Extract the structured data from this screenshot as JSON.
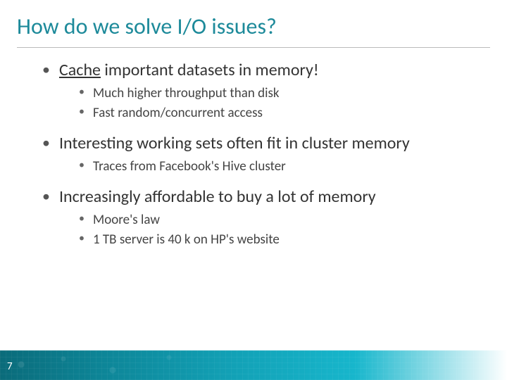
{
  "title": "How do we solve I/O issues?",
  "bullets": [
    {
      "text_pre": "Cache",
      "text_post": " important datasets in memory!",
      "underline_first": true,
      "sub": [
        "Much higher throughput than disk",
        "Fast random/concurrent access"
      ]
    },
    {
      "text": "Interesting working sets often fit in cluster memory",
      "sub": [
        "Traces from Facebook's Hive cluster"
      ]
    },
    {
      "text": "Increasingly affordable to buy a lot of memory",
      "sub": [
        "Moore's law",
        "1 TB server is 40 k on HP's website"
      ]
    }
  ],
  "page_number": "7"
}
